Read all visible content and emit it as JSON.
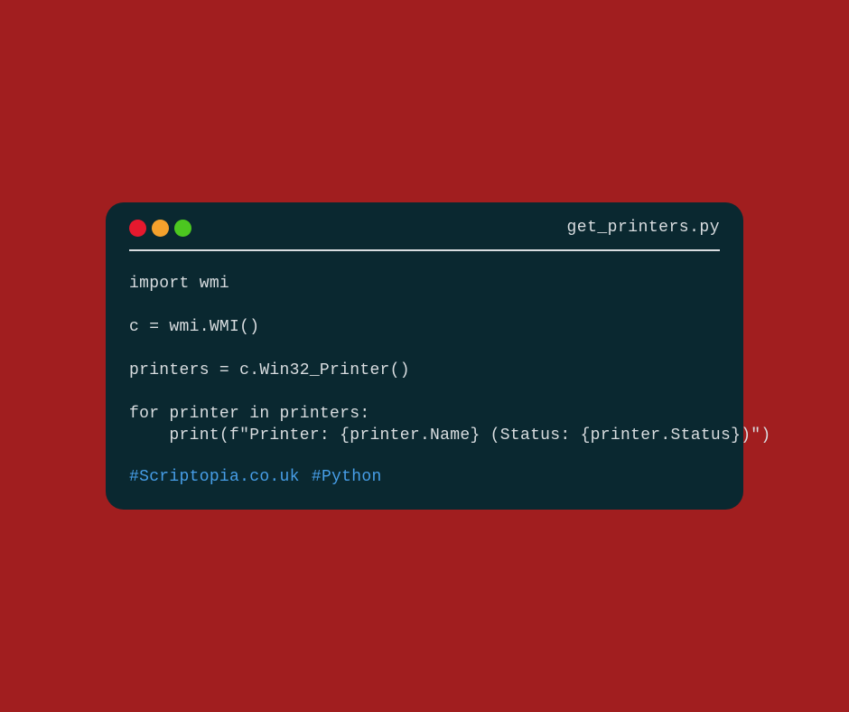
{
  "window": {
    "title": "get_printers.py"
  },
  "code": {
    "content": "import wmi\n\nc = wmi.WMI()\n\nprinters = c.Win32_Printer()\n\nfor printer in printers:\n    print(f\"Printer: {printer.Name} (Status: {printer.Status})\")"
  },
  "hashtags": {
    "tag1": "#Scriptopia.co.uk",
    "tag2": "#Python"
  }
}
